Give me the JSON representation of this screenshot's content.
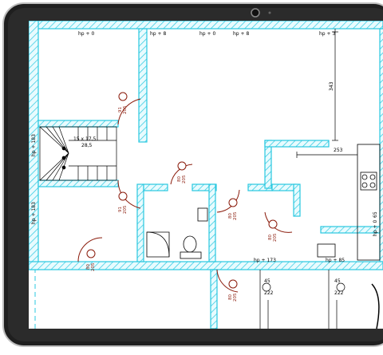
{
  "device": {
    "frame_color": "#2b2b2b",
    "camera": "camera-icon"
  },
  "plan": {
    "wall_color": "#29c8e0",
    "door_color": "#8a1a0a",
    "line_color": "#000000",
    "level_marks": [
      "hp + 0",
      "hp + 8",
      "hp + 0",
      "hp + 8",
      "hp + 3",
      "hp + 173",
      "hp + 85"
    ],
    "stair_left_labels": [
      "hp + 183",
      "hp + 183"
    ],
    "stair_text": [
      "15 x 17,5",
      "28,5"
    ],
    "dimensions": [
      "343",
      "253"
    ],
    "door_tags": [
      {
        "width": "91",
        "height": "205"
      },
      {
        "width": "91",
        "height": "205"
      },
      {
        "width": "80",
        "height": "205"
      },
      {
        "width": "80",
        "height": "205"
      },
      {
        "width": "80",
        "height": "205"
      },
      {
        "width": "80",
        "height": "205"
      },
      {
        "width": "80",
        "height": "205"
      }
    ],
    "side_marks": [
      "65",
      "hp + 0"
    ],
    "lower_numbers": [
      "45",
      "222",
      "45",
      "222"
    ]
  }
}
